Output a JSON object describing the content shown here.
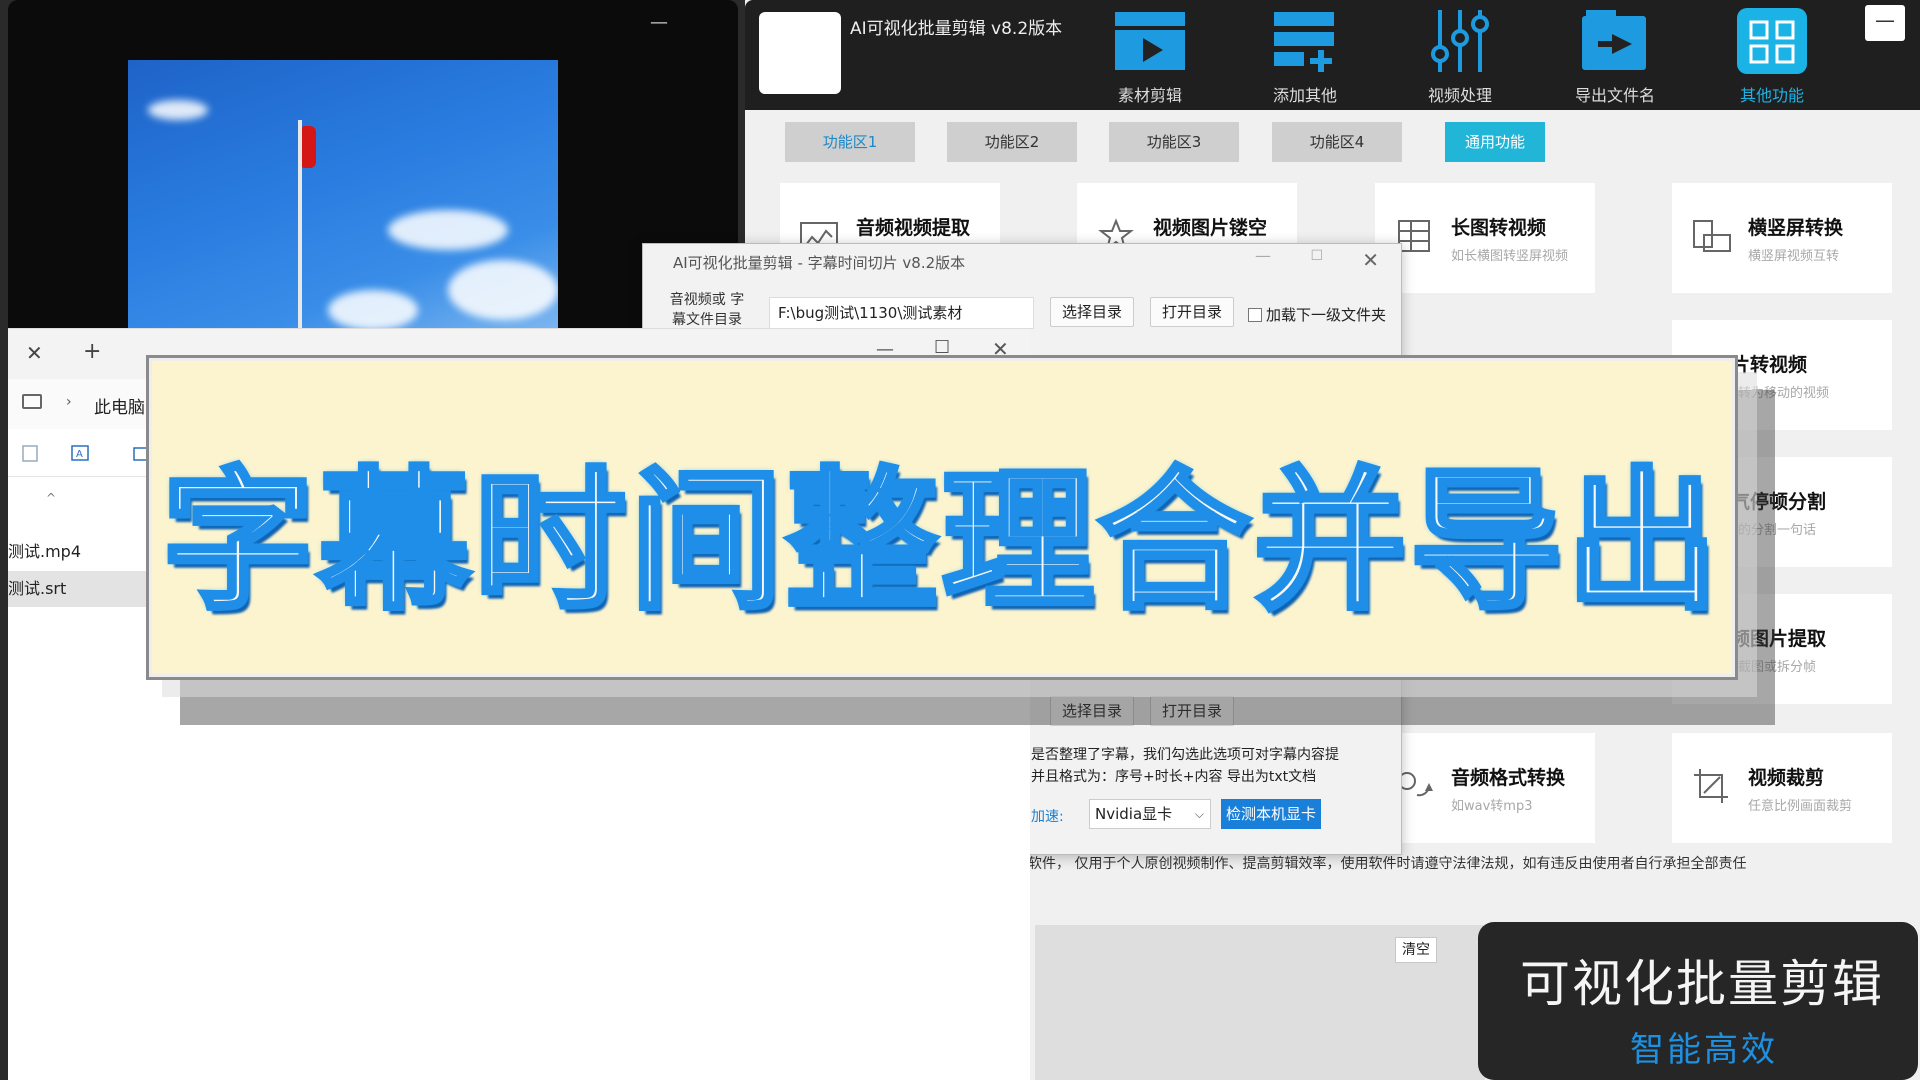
{
  "app": {
    "title": "AI可视化批量剪辑 v8.2版本",
    "min_label": "—",
    "toolbar": [
      {
        "label": "素材剪辑",
        "icon": "clapperboard-icon",
        "active": false
      },
      {
        "label": "添加其他",
        "icon": "add-list-icon",
        "active": false
      },
      {
        "label": "视频处理",
        "icon": "sliders-icon",
        "active": false
      },
      {
        "label": "导出文件名",
        "icon": "export-file-icon",
        "active": false
      },
      {
        "label": "其他功能",
        "icon": "grid-icon",
        "active": true
      }
    ],
    "tabs": [
      "功能区1",
      "功能区2",
      "功能区3",
      "功能区4",
      "通用功能"
    ],
    "cards": [
      {
        "title": "音频视频提取",
        "sub": "",
        "icon": "audio-extract-icon"
      },
      {
        "title": "视频图片镂空",
        "sub": "",
        "icon": "hollow-icon"
      },
      {
        "title": "长图转视频",
        "sub": "如长横图转竖屏视频",
        "icon": "long-image-icon"
      },
      {
        "title": "横竖屏转换",
        "sub": "横竖屏视频互转",
        "icon": "rotate-screen-icon"
      },
      {
        "title": "图片转视频",
        "sub": "图片转为移动的视频",
        "icon": "image-to-video-icon"
      },
      {
        "title": "语气停顿分割",
        "sub": "完整的分割一句话",
        "icon": "pause-split-icon"
      },
      {
        "title": "视频图片提取",
        "sub": "视频截图或拆分帧",
        "icon": "frame-extract-icon"
      },
      {
        "title": "音频格式转换",
        "sub": "如wav转mp3",
        "icon": "audio-convert-icon"
      },
      {
        "title": "视频裁剪",
        "sub": "任意比例画面裁剪",
        "icon": "crop-icon"
      }
    ],
    "disclaimer": "软件， 仅用于个人原创视频制作、提高剪辑效率，使用软件时请遵守法律法规，如有违反由使用者自行承担全部责任",
    "clear_label": "清空",
    "promo_title": "可视化批量剪辑",
    "promo_sub": "智能高效"
  },
  "dialog": {
    "title": "AI可视化批量剪辑 - 字幕时间切片  v8.2版本",
    "label": "音视频或 字幕文件目录",
    "path": "F:\\bug测试\\1130\\测试素材",
    "choose_dir": "选择目录",
    "open_dir": "打开目录",
    "load_sub": "加载下一级文件夹",
    "note_line1": "是否整理了字幕，我们勾选此选项可对字幕内容提",
    "note_line2": "并且格式为：序号+时长+内容 导出为txt文档",
    "accel_label": "加速:",
    "gpu_value": "Nvidia显卡",
    "detect_gpu": "检测本机显卡"
  },
  "explorer": {
    "address": "此电脑",
    "files": [
      "测试.mp4",
      "测试.srt"
    ],
    "selected_index": 1
  },
  "banner": {
    "text": "字幕时间整理合并导出"
  },
  "colors": {
    "accent": "#21b5d8",
    "toolbar_active": "#1bb3e6",
    "banner_stroke": "#1e8ee8",
    "banner_bg": "#fbf4cf"
  }
}
